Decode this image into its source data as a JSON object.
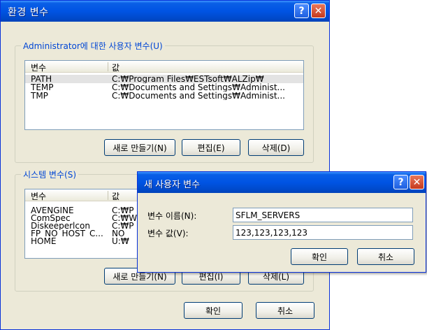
{
  "main_window": {
    "title": "환경 변수",
    "help_glyph": "?",
    "close_glyph": "✕",
    "user_vars": {
      "legend": "Administrator에 대한 사용자 변수(U)",
      "columns": [
        "변수",
        "값"
      ],
      "rows": [
        {
          "name": "PATH",
          "value": "C:₩Program Files₩ESTsoft₩ALZip₩",
          "selected": true
        },
        {
          "name": "TEMP",
          "value": "C:₩Documents and Settings₩Administ..."
        },
        {
          "name": "TMP",
          "value": "C:₩Documents and Settings₩Administ..."
        }
      ],
      "buttons": {
        "new": "새로 만들기(N)",
        "edit": "편집(E)",
        "delete": "삭제(D)"
      }
    },
    "system_vars": {
      "legend": "시스템 변수(S)",
      "columns": [
        "변수",
        "값"
      ],
      "rows": [
        {
          "name": "AVENGINE",
          "value": "C:₩P"
        },
        {
          "name": "ComSpec",
          "value": "C:₩W"
        },
        {
          "name": "Diskeeperlcon",
          "value": "C:₩P"
        },
        {
          "name": "FP_NO_HOST_C...",
          "value": "NO"
        },
        {
          "name": "HOME",
          "value": "U:₩"
        }
      ],
      "buttons": {
        "new": "새로 만들기(N)",
        "edit": "편집(I)",
        "delete": "삭제(L)"
      }
    },
    "footer": {
      "ok": "확인",
      "cancel": "취소"
    }
  },
  "dialog": {
    "title": "새 사용자 변수",
    "help_glyph": "?",
    "close_glyph": "✕",
    "name_label": "변수 이름(N):",
    "name_value": "SFLM_SERVERS",
    "value_label": "변수 값(V):",
    "value_value": "123,123,123,123",
    "ok": "확인",
    "cancel": "취소"
  },
  "colors": {
    "titlebar": "#0054e3",
    "window_bg": "#ece9d8",
    "group_legend": "#0046d5",
    "close_button": "#c6391d"
  }
}
